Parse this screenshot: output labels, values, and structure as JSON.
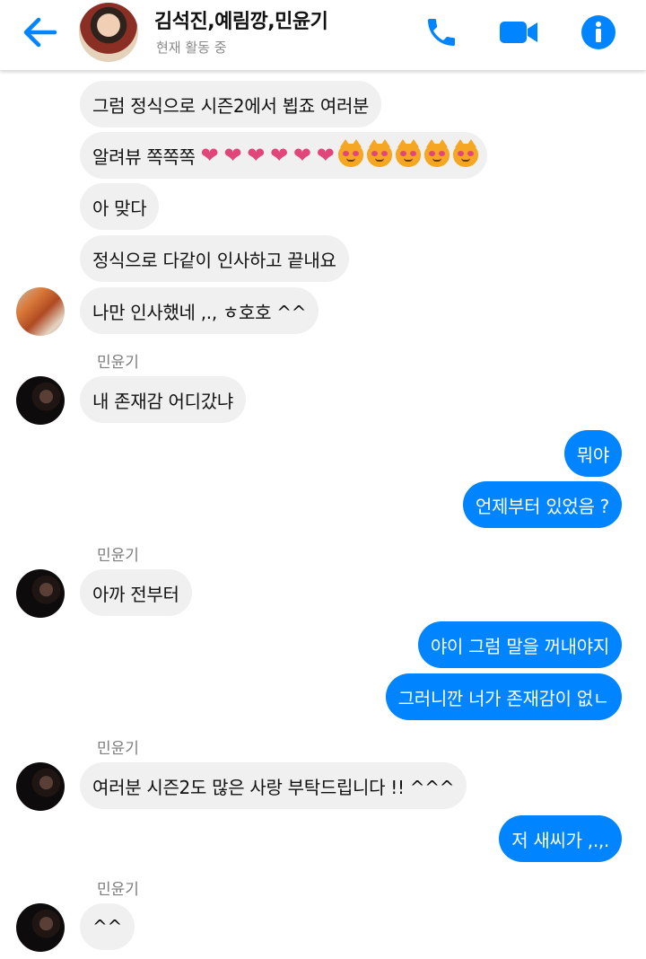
{
  "header": {
    "title": "김석진,예림깡,민윤기",
    "status": "현재 활동 중",
    "colors": {
      "accent": "#0084ff"
    },
    "icons": [
      "back-arrow-icon",
      "phone-icon",
      "video-camera-icon",
      "info-icon"
    ]
  },
  "messages": {
    "m1": "그럼 정식으로 시즌2에서 뵙죠 여러분",
    "m2_text": "알려뷰 쪽쪽쪽",
    "m2_emojis": {
      "hearts": [
        "❤",
        "❤",
        "❤",
        "❤",
        "❤",
        "❤"
      ],
      "cats": [
        "heart-eyes-cat",
        "heart-eyes-cat",
        "heart-eyes-cat",
        "heart-eyes-cat",
        "heart-eyes-cat"
      ]
    },
    "m3": "아 맞다",
    "m4": "정식으로 다같이 인사하고 끝내요",
    "m5": "나만 인사했네 ,., ㅎ호호 ^^",
    "sender1": "민윤기",
    "m6": "내 존재감 어디갔냐",
    "m7": "뭐야",
    "m8": "언제부터 있었음 ?",
    "sender2": "민윤기",
    "m9": "아까 전부터",
    "m10": "야이 그럼 말을 꺼내야지",
    "m11": "그러니깐 너가 존재감이 없ㄴ",
    "sender3": "민윤기",
    "m12": "여러분 시즌2도 많은 사랑 부탁드립니다 !! ^^^",
    "m13": "저 새씨가 ,.,.",
    "sender4": "민윤기",
    "m14": "^^"
  }
}
